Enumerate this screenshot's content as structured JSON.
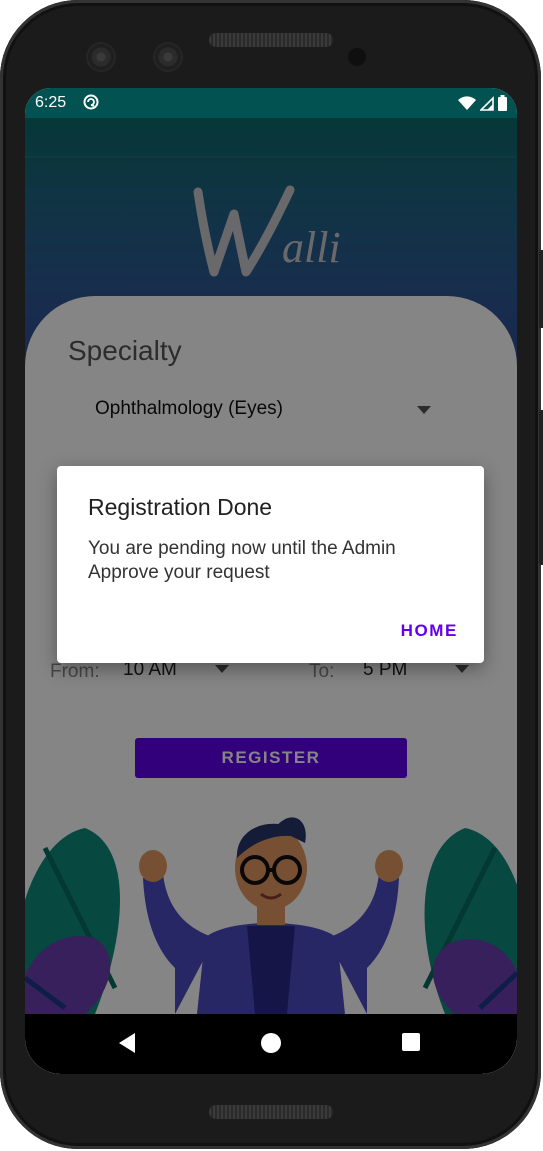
{
  "status_bar": {
    "time": "6:25",
    "icons": [
      "notification-icon",
      "wifi-icon",
      "signal-icon",
      "battery-icon"
    ]
  },
  "app": {
    "logo_text": "Walli",
    "specialty_label": "Specialty",
    "specialty_value": "Ophthalmology (Eyes)",
    "hours": {
      "from_label": "From:",
      "from_value": "10 AM",
      "to_label": "To:",
      "to_value": "5 PM"
    },
    "register_label": "REGISTER"
  },
  "dialog": {
    "title": "Registration Done",
    "message": "You are pending now until the Admin Approve your request",
    "button_label": "HOME"
  },
  "colors": {
    "accent": "#6200ee",
    "status_bar": "#035252",
    "header_top": "#0b6b6a",
    "header_bottom": "#364c98"
  },
  "nav_bar": {
    "buttons": [
      "back-icon",
      "home-icon",
      "recents-icon"
    ]
  }
}
